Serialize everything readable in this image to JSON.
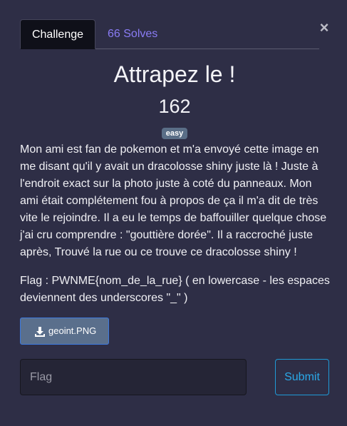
{
  "modal": {
    "close_label": "×",
    "tabs": [
      {
        "label": "Challenge",
        "active": true
      },
      {
        "label": "66 Solves",
        "active": false
      }
    ],
    "title": "Attrapez le !",
    "points": "162",
    "difficulty": "easy",
    "description": "Mon ami est fan de pokemon et m'a envoyé cette image en me disant qu'il y avait un dracolosse shiny juste là ! Juste à l'endroit exact sur la photo juste à coté du panneaux. Mon ami était complétement fou à propos de ça il m'a dit de très vite le rejoindre. Il a eu le temps de baffouiller quelque chose j'ai cru comprendre : \"gouttière dorée\". Il a raccroché juste après, Trouvé la rue ou ce trouve ce dracolosse shiny !",
    "flag_format": "Flag : PWNME{nom_de_la_rue} ( en lowercase - les espaces deviennent des underscores \"_\" )",
    "file": {
      "name": "geoint.PNG",
      "icon": "download-icon"
    },
    "flag_input": {
      "placeholder": "Flag",
      "value": ""
    },
    "submit_label": "Submit"
  },
  "colors": {
    "background": "#2e2e46",
    "tab_active_bg": "#0f1019",
    "solves_link": "#8a7cf5",
    "badge_bg": "#5a6e87",
    "file_button_bg": "#5a6f8c",
    "submit_accent": "#2aa8e8"
  }
}
